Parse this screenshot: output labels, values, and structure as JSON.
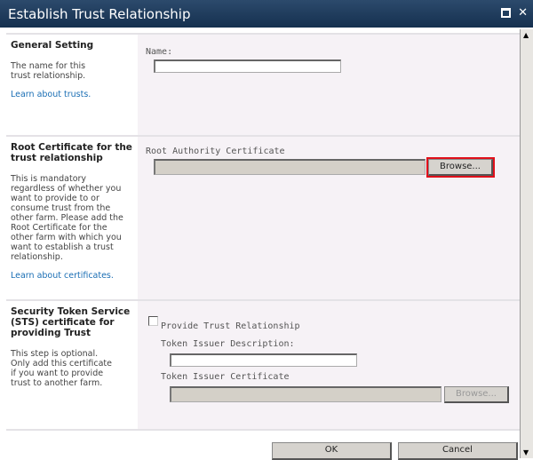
{
  "title": "Establish Trust Relationship",
  "sections": [
    {
      "heading": "General Setting",
      "desc": "The name for this trust relationship.",
      "link": "Learn about trusts.",
      "field_label": "Name:",
      "field_value": ""
    },
    {
      "heading": "Root Certificate for the trust relationship",
      "desc": "This is mandatory regardless of whether you want to provide to or consume trust from the other farm. Please add the Root Certificate for the other farm with which you want to establish a trust relationship.",
      "link": "Learn about certificates.",
      "field_label": "Root Authority Certificate",
      "browse": "Browse..."
    },
    {
      "heading": "Security Token Service (STS) certificate for providing Trust",
      "desc": "This step is optional. Only add this certificate if you want to provide trust to another farm.",
      "checkbox_label": "Provide Trust Relationship",
      "checked": false,
      "desc_label": "Token Issuer Description:",
      "cert_label": "Token Issuer Certificate",
      "browse": "Browse..."
    }
  ],
  "buttons": {
    "ok": "OK",
    "cancel": "Cancel"
  }
}
